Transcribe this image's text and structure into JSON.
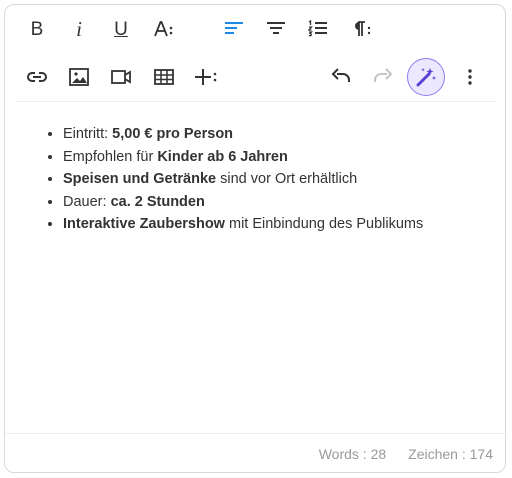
{
  "toolbar": {
    "bold_glyph": "B",
    "italic_glyph": "i",
    "underline_glyph": "U",
    "colors": {
      "accent": "#1e88e5",
      "magic_bg": "#ece8ff",
      "magic_border": "#8d7df0",
      "magic_icon": "#5b3fd6"
    }
  },
  "content": {
    "items": [
      {
        "plain_before": "Eintritt: ",
        "bold": "5,00 € pro Person",
        "plain_after": ""
      },
      {
        "plain_before": "Empfohlen für ",
        "bold": "Kinder ab 6 Jahren",
        "plain_after": ""
      },
      {
        "plain_before": "",
        "bold": "Speisen und Getränke",
        "plain_after": " sind vor Ort erhältlich"
      },
      {
        "plain_before": "Dauer: ",
        "bold": "ca. 2 Stunden",
        "plain_after": ""
      },
      {
        "plain_before": "",
        "bold": "Interaktive Zaubershow",
        "plain_after": " mit Einbindung des Publikums"
      }
    ]
  },
  "footer": {
    "words": "Words : 28",
    "chars": "Zeichen : 174"
  }
}
